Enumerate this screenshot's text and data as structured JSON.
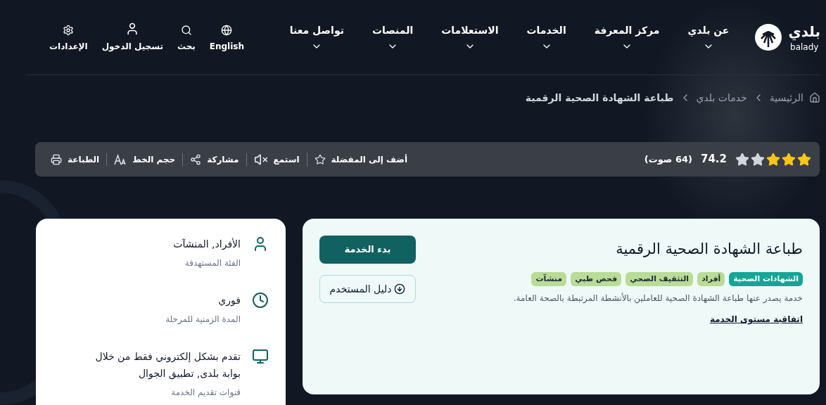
{
  "header": {
    "logo": {
      "arabic": "بلدي",
      "latin": "balady"
    },
    "nav": [
      {
        "label": "عن بلدي"
      },
      {
        "label": "مركز المعرفة"
      },
      {
        "label": "الخدمات"
      },
      {
        "label": "الاستعلامات"
      },
      {
        "label": "المنصات"
      },
      {
        "label": "تواصل معنا"
      }
    ],
    "utilities": [
      {
        "kind": "globe",
        "label": "English"
      },
      {
        "kind": "search",
        "label": "بحث"
      },
      {
        "kind": "user",
        "label": "تسجيل الدخول"
      },
      {
        "kind": "settings",
        "label": "الإعدادات"
      }
    ]
  },
  "breadcrumb": [
    "الرئيسية",
    "خدمات بلدي",
    "طباعة الشهادة الصحية الرقمية"
  ],
  "toolbar": {
    "stars": 3,
    "rating": "74.2",
    "votes": "(64 صوت)",
    "actions": [
      {
        "kind": "favorite",
        "label": "أضف إلى المفضلة"
      },
      {
        "kind": "listen",
        "label": "استمع"
      },
      {
        "kind": "share",
        "label": "مشاركة"
      },
      {
        "kind": "font",
        "label": "حجم الخط"
      },
      {
        "kind": "print",
        "label": "الطباعة"
      }
    ]
  },
  "service": {
    "title": "طباعة الشهادة الصحية الرقمية",
    "tags": [
      {
        "label": "الشهادات الصحية",
        "color": "#14a595"
      },
      {
        "label": "أفراد",
        "color": "#b9dc96"
      },
      {
        "label": "التثقيف الصحي",
        "color": "#b9dc96"
      },
      {
        "label": "فحص طبي",
        "color": "#b9dc96"
      },
      {
        "label": "منشآت",
        "color": "#b9dc96"
      }
    ],
    "description": "خدمة يصدر عنها طباعة الشهادة الصحية للعاملين بالأنشطة المرتبطة بالصحة العامة.",
    "sla_link": "اتفاقية مستوى الخدمة",
    "start_button": "بدء الخدمة",
    "guide_button": "دليل المستخدم"
  },
  "details": [
    {
      "kind": "audience",
      "value": "الأفراد, المنشآت",
      "label": "الفئة المستهدفة"
    },
    {
      "kind": "duration",
      "value": "فوري",
      "label": "المدة الزمنية للمرحلة"
    },
    {
      "kind": "channels",
      "value": "تقدم بشكل إلكتروني فقط من خلال بوابة بلدى, تطبيق الجوال",
      "label": "قنوات تقديم الخدمة"
    }
  ]
}
